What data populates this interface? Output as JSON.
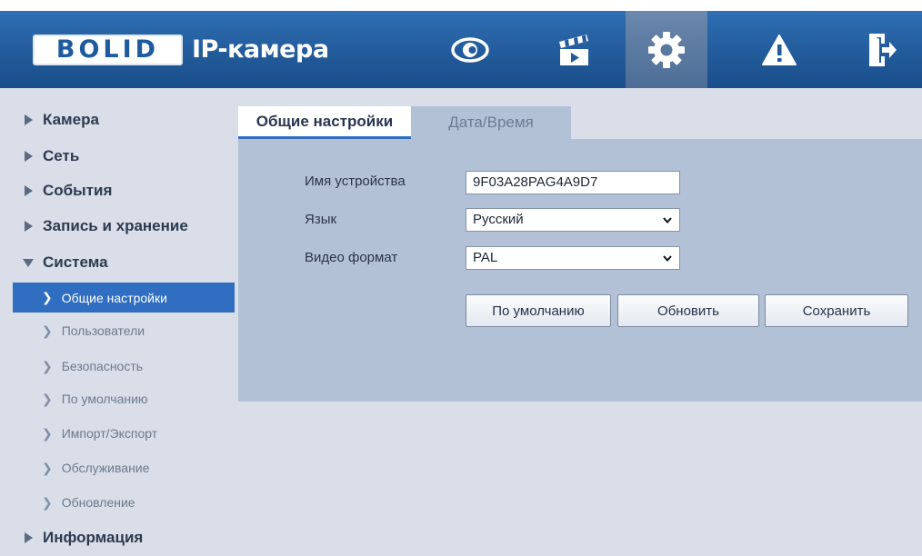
{
  "header": {
    "logo": "BOLID",
    "title": "IP-камера",
    "nav": [
      {
        "icon": "eye-icon",
        "label": "Live view"
      },
      {
        "icon": "clapperboard-icon",
        "label": "Playback"
      },
      {
        "icon": "gear-icon",
        "label": "Settings"
      },
      {
        "icon": "warning-icon",
        "label": "Alarm"
      },
      {
        "icon": "logout-icon",
        "label": "Logout"
      }
    ],
    "active_nav": "gear-icon"
  },
  "sidebar": {
    "sections": [
      {
        "label": "Камера",
        "expanded": false
      },
      {
        "label": "Сеть",
        "expanded": false
      },
      {
        "label": "События",
        "expanded": false
      },
      {
        "label": "Запись и хранение",
        "expanded": false
      },
      {
        "label": "Система",
        "expanded": true
      },
      {
        "label": "Информация",
        "expanded": false
      }
    ],
    "system_items": [
      {
        "label": "Общие настройки",
        "active": true
      },
      {
        "label": "Пользователи",
        "active": false
      },
      {
        "label": "Безопасность",
        "active": false
      },
      {
        "label": "По умолчанию",
        "active": false
      },
      {
        "label": "Импорт/Экспорт",
        "active": false
      },
      {
        "label": "Обслуживание",
        "active": false
      },
      {
        "label": "Обновление",
        "active": false
      }
    ]
  },
  "tabs": {
    "general": "Общие настройки",
    "datetime": "Дата/Время"
  },
  "form": {
    "device_name_label": "Имя устройства",
    "device_name_value": "9F03A28PAG4A9D7",
    "language_label": "Язык",
    "language_value": "Русский",
    "video_format_label": "Видео формат",
    "video_format_value": "PAL"
  },
  "buttons": {
    "default": "По умолчанию",
    "refresh": "Обновить",
    "save": "Сохранить"
  },
  "colors": {
    "header": "#225b9b",
    "active_item": "#2f6ec0",
    "panel": "#b3c1d7",
    "background": "#d9dee8"
  }
}
